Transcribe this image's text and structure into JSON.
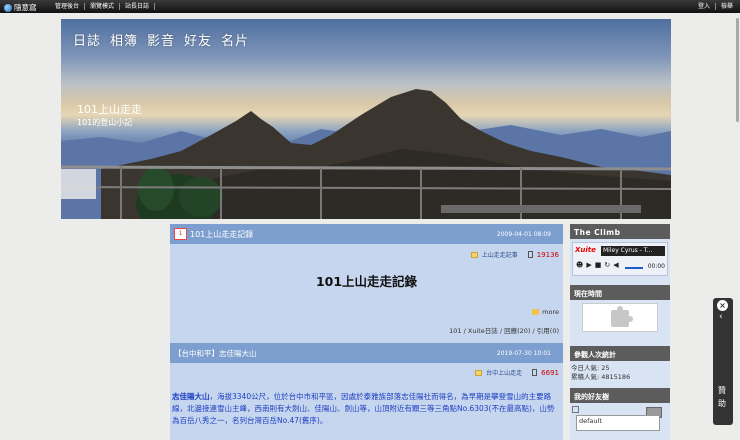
{
  "topbar": {
    "brand": "隨意窩",
    "menu": [
      "管理後台",
      "瀏覽模式",
      "站長日誌"
    ],
    "right": [
      "登入",
      "檢舉"
    ]
  },
  "header": {
    "nav": [
      "日誌",
      "相簿",
      "影音",
      "好友",
      "名片"
    ],
    "title": "101上山走走",
    "subtitle": "101的登山小記"
  },
  "posts": [
    {
      "title": "101上山走走記錄",
      "date": "2009-04-01 08:09",
      "category": "上山走走記事",
      "views": "19136",
      "heading": "101上山走走記錄",
      "more": "more",
      "footer": "101 / Xuite日誌 / 回應(20) / 引用(0)"
    },
    {
      "title": "【台中和平】志佳陽大山",
      "date": "2019-07-30 10:01",
      "category": "台中上山走走",
      "views": "6691",
      "body_bold": "志佳陽大山",
      "body": "，海拔3340公尺，位於台中市和平區，因處於泰雅族部落志佳陽社而得名，為早期是攀登雪山的主要路線，北邊接連雪山主峰，西南則有大劍山、佳陽山、劍山等，山頂附近有顆三等三角點No.6303(不在最高點)，山勢為百岳八秀之一，名列台灣百岳No.47(舊序)。"
    }
  ],
  "sidebar": {
    "climb_title": "The Climb",
    "player": {
      "logo": "Xuite",
      "track": "Miley Cyrus - T...",
      "time": "00:00"
    },
    "time_title": "現在時間",
    "visitors_title": "參觀人次統計",
    "today": "今日人氣: 25",
    "total": "累積人氣: 4815186",
    "friends_title": "我的好友樹",
    "friends_default": "default"
  },
  "sidetab": {
    "close": "×",
    "label": "贊助"
  }
}
